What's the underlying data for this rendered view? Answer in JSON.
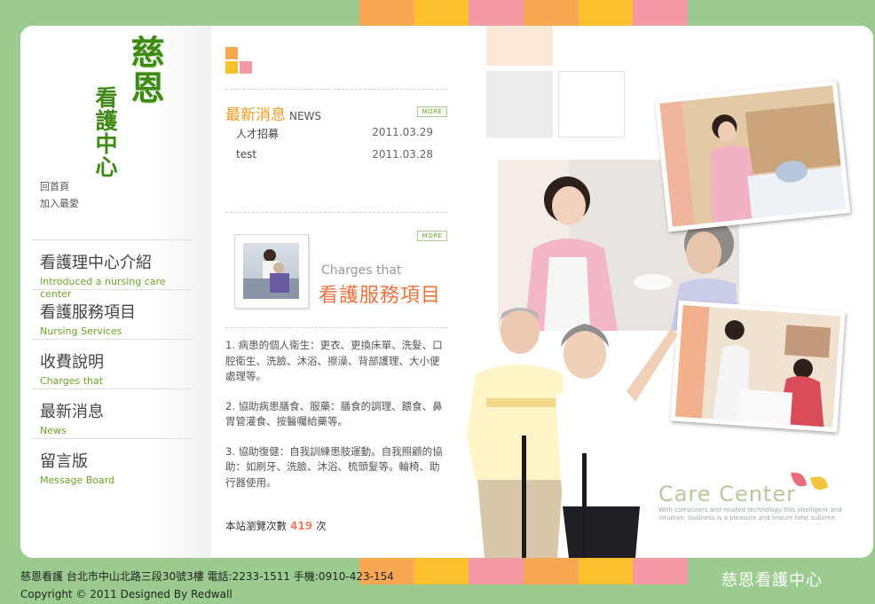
{
  "colors": {
    "background": "#9bcb8f",
    "stripes": [
      "#f9a852",
      "#fbc02d",
      "#f39aa4",
      "#f9a852",
      "#fbc02d",
      "#f39aa4"
    ],
    "accent_green": "#3d8a17",
    "accent_orange": "#f39a1e",
    "accent_red": "#f2703e"
  },
  "brand": {
    "name_big": "慈恩",
    "name_small": "看護中心"
  },
  "quick_links": [
    "回首頁",
    "加入最愛"
  ],
  "nav": [
    {
      "zh": "看護理中心介紹",
      "en": "Introduced a nursing care center"
    },
    {
      "zh": "看護服務項目",
      "en": "Nursing Services"
    },
    {
      "zh": "收費說明",
      "en": "Charges that"
    },
    {
      "zh": "最新消息",
      "en": "News"
    },
    {
      "zh": "留言版",
      "en": "Message Board"
    }
  ],
  "news": {
    "title_zh": "最新消息",
    "title_en": "NEWS",
    "more_label": "MORE",
    "items": [
      {
        "title": "人才招募",
        "date": "2011.03.29"
      },
      {
        "title": "test",
        "date": "2011.03.28"
      }
    ]
  },
  "charges": {
    "more_label": "MORE",
    "title_en": "Charges that",
    "title_zh": "看護服務項目"
  },
  "services": [
    "1. 病患的個人衛生：更衣、更換床單、洗髮、口腔衛生、洗臉、沐浴、擦澡、背部護理、大小便處理等。",
    "2. 協助病患膳食、服藥：膳食的調理、餵食、鼻胃管灌食、按醫囑給藥等。",
    "3. 協助復健：自我訓練患肢運動。自我照顧的協助：如刷牙、洗臉、沐浴、梳頭髮等。輪椅、助行器使用。"
  ],
  "visits": {
    "prefix": "本站瀏覽次數",
    "count": "419",
    "suffix": "次"
  },
  "care_center": {
    "title": "Care Center",
    "subtitle": "With computers and related technology this intelligent and intuitive, business is a pleasure and leisure time sublime"
  },
  "footer": {
    "line1": "慈恩看護 台北市中山北路三段30號3樓 電話:2233-1511 手機:0910-423-154",
    "line2": "Copyright © 2011 Designed By Redwall",
    "brand": "慈恩看護中心"
  }
}
